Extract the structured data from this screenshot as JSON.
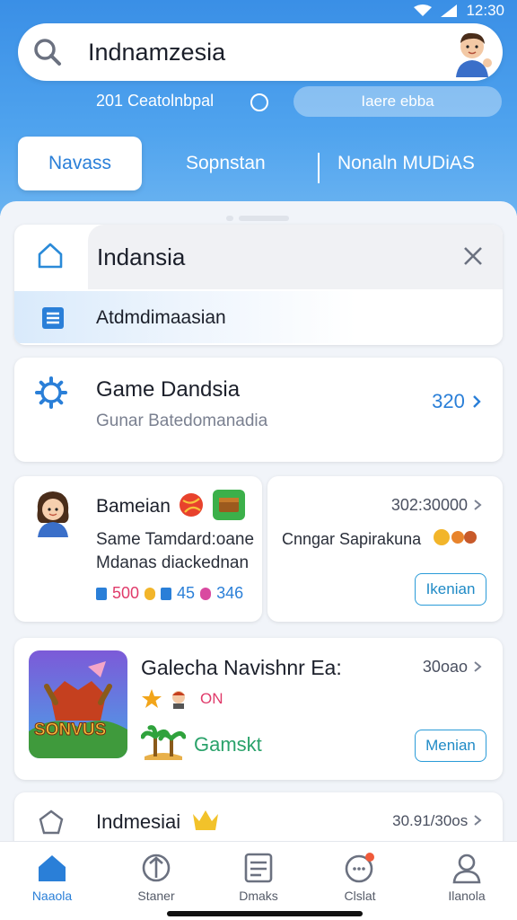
{
  "status": {
    "time": "12:30"
  },
  "search": {
    "value": "Indnamzesia"
  },
  "subrow": {
    "label": "201 Ceatolnbpal",
    "pill": "Iaere ebba"
  },
  "tabs": [
    "Navass",
    "Sopnstan",
    "Nonaln MUDiAS"
  ],
  "suggest": {
    "query": "Indansia",
    "row": "Atdmdimaasian"
  },
  "game_card": {
    "title": "Game Dandsia",
    "subtitle": "Gunar Batedomanadia",
    "count": "320"
  },
  "user_card": {
    "title": "Bameian",
    "line1": "Same Tamdard:oane",
    "line2": "Mdanas diackednan",
    "stat1": "500",
    "stat2": "45",
    "stat3": "346"
  },
  "promo_card": {
    "number": "302:30000",
    "line1": "Cnngar Sapirakuna",
    "button": "Ikenian"
  },
  "feature_card": {
    "title": "Galecha Navishnr Ea:",
    "number": "30oao",
    "status": "ON",
    "label": "Gamskt",
    "button": "Menian",
    "art_text": "SONVUS"
  },
  "list_card": {
    "title": "Indmesiai",
    "number": "30.91/30os"
  },
  "nav": [
    {
      "label": "Naaola",
      "icon": "home-icon"
    },
    {
      "label": "Staner",
      "icon": "shield-icon"
    },
    {
      "label": "Dmaks",
      "icon": "list-icon"
    },
    {
      "label": "Clslat",
      "icon": "chat-icon"
    },
    {
      "label": "Ilanola",
      "icon": "profile-icon"
    }
  ],
  "colors": {
    "accent": "#2a7fd8",
    "header_top": "#3a8fe6",
    "header_bottom": "#6ab3f1",
    "stat_pink": "#e03a6a"
  }
}
